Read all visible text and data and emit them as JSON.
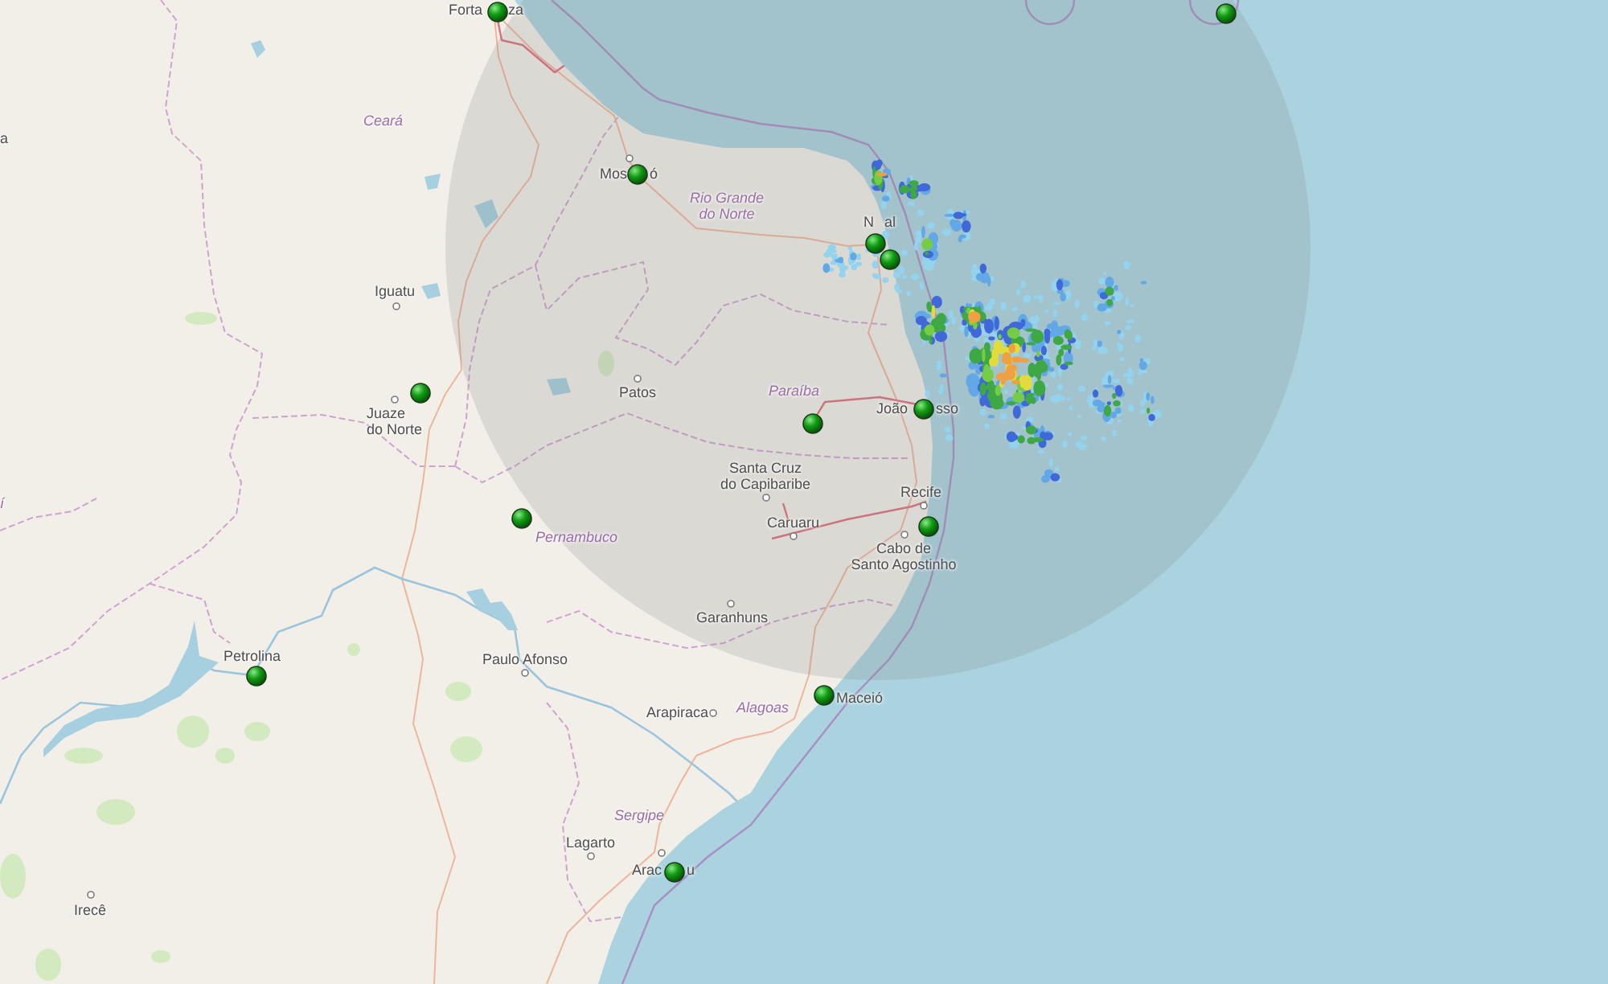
{
  "map": {
    "state_labels": [
      {
        "lines": [
          "Ceará"
        ]
      },
      {
        "lines": [
          "Rio Grande",
          "do Norte"
        ]
      },
      {
        "lines": [
          "Paraíba"
        ]
      },
      {
        "lines": [
          "Pernambuco"
        ]
      },
      {
        "lines": [
          "Alagoas"
        ]
      },
      {
        "lines": [
          "Sergipe"
        ]
      },
      {
        "lines": [
          "í"
        ]
      }
    ],
    "city_labels": [
      {
        "lines": [
          "a"
        ]
      },
      {
        "lines": [
          "Forta"
        ],
        "continued": "za"
      },
      {
        "lines": [
          "Mos"
        ],
        "continued": "ó"
      },
      {
        "lines": [
          "Iguatu"
        ]
      },
      {
        "lines": [
          "Juaze",
          "do Norte"
        ]
      },
      {
        "lines": [
          "Patos"
        ]
      },
      {
        "lines": [
          "N"
        ],
        "continued": "al"
      },
      {
        "lines": [
          "João"
        ],
        "continued": "sso"
      },
      {
        "lines": [
          "Santa Cruz",
          "do Capibaribe"
        ]
      },
      {
        "lines": [
          "Recife"
        ]
      },
      {
        "lines": [
          "Caruaru"
        ]
      },
      {
        "lines": [
          "Cabo de",
          "Santo Agostinho"
        ]
      },
      {
        "lines": [
          "Garanhuns"
        ]
      },
      {
        "lines": [
          "Paulo Afonso"
        ]
      },
      {
        "lines": [
          "Petrolina"
        ]
      },
      {
        "lines": [
          "Arapiraca"
        ]
      },
      {
        "lines": [
          "Maceió"
        ]
      },
      {
        "lines": [
          "Lagarto"
        ]
      },
      {
        "lines": [
          "Arac"
        ],
        "continued": "u"
      },
      {
        "lines": [
          "Irecê"
        ]
      }
    ]
  }
}
